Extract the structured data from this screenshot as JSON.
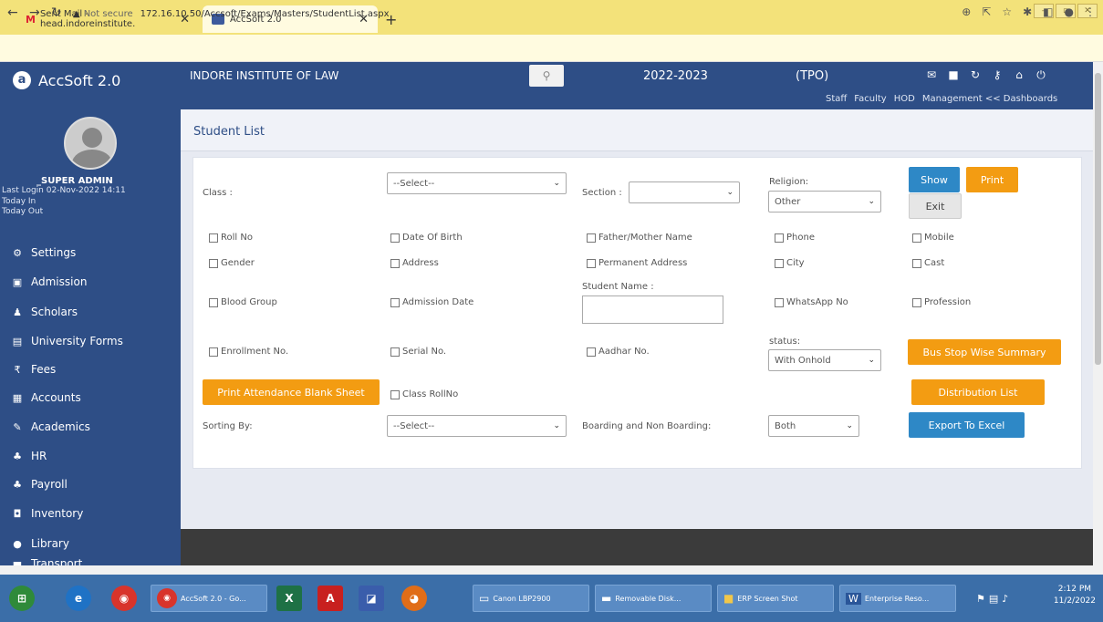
{
  "browser": {
    "tabs": [
      {
        "title": "Sent Mail - head.indoreinstitute.",
        "close": "✕"
      },
      {
        "title": "AccSoft 2.0",
        "close": "✕"
      }
    ],
    "new_tab": "+",
    "url_security": "Not secure",
    "url": "172.16.10.50/Accsoft/Exams/Masters/StudentList.aspx"
  },
  "app": {
    "name": "AccSoft 2.0",
    "institute": "INDORE INSTITUTE OF LAW",
    "year": "2022-2023",
    "tpo": "(TPO)",
    "top_links": [
      "Staff",
      "Faculty",
      "HOD",
      "Management << Dashboards"
    ]
  },
  "user": {
    "name": "_SUPER ADMIN",
    "last_login": "Last Login  02-Nov-2022 14:11",
    "today_in": "Today In",
    "today_out": "Today Out"
  },
  "sidebar": {
    "items": [
      {
        "label": "Settings",
        "icon": "gear-icon"
      },
      {
        "label": "Admission",
        "icon": "id-card-icon"
      },
      {
        "label": "Scholars",
        "icon": "user-icon"
      },
      {
        "label": "University Forms",
        "icon": "document-icon"
      },
      {
        "label": "Fees",
        "icon": "rupee-icon"
      },
      {
        "label": "Accounts",
        "icon": "calculator-icon"
      },
      {
        "label": "Academics",
        "icon": "pen-icon"
      },
      {
        "label": "HR",
        "icon": "users-icon"
      },
      {
        "label": "Payroll",
        "icon": "users-icon"
      },
      {
        "label": "Inventory",
        "icon": "box-icon"
      },
      {
        "label": "Library",
        "icon": "book-icon"
      },
      {
        "label": "Transport",
        "icon": "bus-icon"
      }
    ]
  },
  "page": {
    "title": "Student List",
    "class_label": "Class :",
    "class_value": "--Select--",
    "section_label": "Section :",
    "section_value": "",
    "religion_label": "Religion:",
    "religion_value": "Other",
    "show": "Show",
    "print": "Print",
    "exit": "Exit",
    "checkboxes": {
      "roll_no": "Roll No",
      "dob": "Date Of Birth",
      "parent": "Father/Mother Name",
      "phone": "Phone",
      "mobile": "Mobile",
      "gender": "Gender",
      "address": "Address",
      "perm_address": "Permanent Address",
      "city": "City",
      "cast": "Cast",
      "blood": "Blood Group",
      "adm_date": "Admission Date",
      "whatsapp": "WhatsApp No",
      "profession": "Profession",
      "enroll": "Enrollment No.",
      "serial": "Serial No.",
      "aadhar": "Aadhar No.",
      "class_roll": "Class RollNo"
    },
    "student_name_label": "Student Name :",
    "student_name_value": "",
    "status_label": "status:",
    "status_value": "With Onhold",
    "bus_summary": "Bus Stop Wise Summary",
    "print_attendance": "Print Attendance Blank Sheet",
    "distribution": "Distribution List",
    "sorting_label": "Sorting By:",
    "sorting_value": "--Select--",
    "boarding_label": "Boarding and Non Boarding:",
    "boarding_value": "Both",
    "export": "Export To Excel"
  },
  "taskbar": {
    "tasks": [
      "AccSoft 2.0 - Go...",
      "Canon LBP2900",
      "Removable Disk...",
      "ERP Screen Shot",
      "Enterprise Reso..."
    ],
    "time": "2:12 PM",
    "date": "11/2/2022"
  },
  "colors": {
    "header": "#2e4e86",
    "orange": "#f39c12",
    "blue": "#2e88c6"
  }
}
